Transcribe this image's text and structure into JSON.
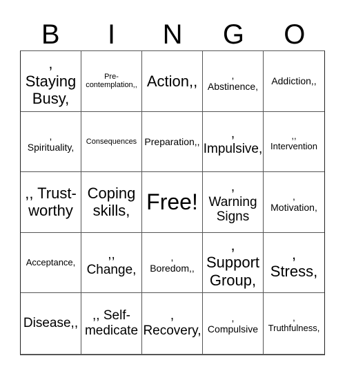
{
  "header": {
    "letters": [
      "B",
      "I",
      "N",
      "G",
      "O"
    ]
  },
  "cells": [
    {
      "text": ",\nStaying\nBusy,",
      "size": "s-xl"
    },
    {
      "text": "Pre-\ncontemplation,,",
      "size": "s-xs"
    },
    {
      "text": "Action,,",
      "size": "s-xl"
    },
    {
      "text": ",\nAbstinence,",
      "size": "s-md"
    },
    {
      "text": "Addiction,,",
      "size": "s-md"
    },
    {
      "text": ",\nSpirituality,",
      "size": "s-md"
    },
    {
      "text": "Consequences",
      "size": "s-xs"
    },
    {
      "text": "Preparation,,",
      "size": "s-md"
    },
    {
      "text": ",\nImpulsive,",
      "size": "s-lg"
    },
    {
      "text": ",,\nIntervention",
      "size": "s-sm"
    },
    {
      "text": ",, Trust-\nworthy",
      "size": "s-xl"
    },
    {
      "text": "Coping\nskills,",
      "size": "s-xl"
    },
    {
      "text": "Free!",
      "size": "s-free"
    },
    {
      "text": ",\nWarning\nSigns",
      "size": "s-lg"
    },
    {
      "text": ",\nMotivation,",
      "size": "s-md"
    },
    {
      "text": "Acceptance,",
      "size": "s-sm"
    },
    {
      "text": ",,\nChange,",
      "size": "s-lg"
    },
    {
      "text": ",\nBoredom,,",
      "size": "s-md"
    },
    {
      "text": ",\nSupport\nGroup,",
      "size": "s-xl"
    },
    {
      "text": ",\nStress,",
      "size": "s-xl"
    },
    {
      "text": "Disease,,",
      "size": "s-lg"
    },
    {
      "text": ",, Self-\nmedicate",
      "size": "s-lg"
    },
    {
      "text": ",\nRecovery,",
      "size": "s-lg"
    },
    {
      "text": ",\nCompulsive",
      "size": "s-md"
    },
    {
      "text": ",\nTruthfulness,",
      "size": "s-sm"
    }
  ]
}
